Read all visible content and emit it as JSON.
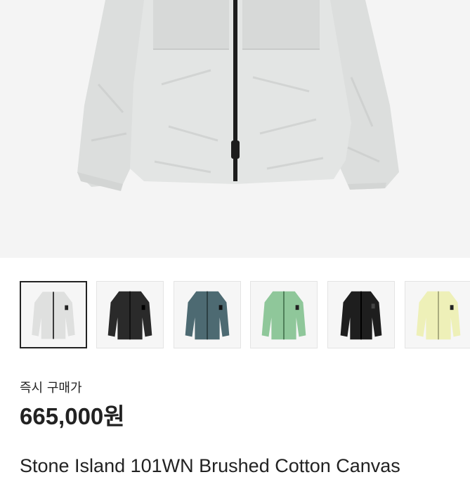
{
  "product": {
    "main_image": "light-grey-jacket-photo",
    "thumbnails": [
      {
        "color_name": "light-grey",
        "jacket_color": "#dfe0df",
        "selected": true
      },
      {
        "color_name": "black",
        "jacket_color": "#2a2a2a",
        "selected": false
      },
      {
        "color_name": "teal-grey",
        "jacket_color": "#4d6a72",
        "selected": false
      },
      {
        "color_name": "sage-green",
        "jacket_color": "#8fc79a",
        "selected": false
      },
      {
        "color_name": "black",
        "jacket_color": "#1e1e1e",
        "selected": false
      },
      {
        "color_name": "pale-yellow",
        "jacket_color": "#eef0b8",
        "selected": false
      }
    ],
    "purchase_label": "즉시 구매가",
    "price": "665,000원",
    "title": "Stone Island 101WN Brushed Cotton Canvas"
  }
}
